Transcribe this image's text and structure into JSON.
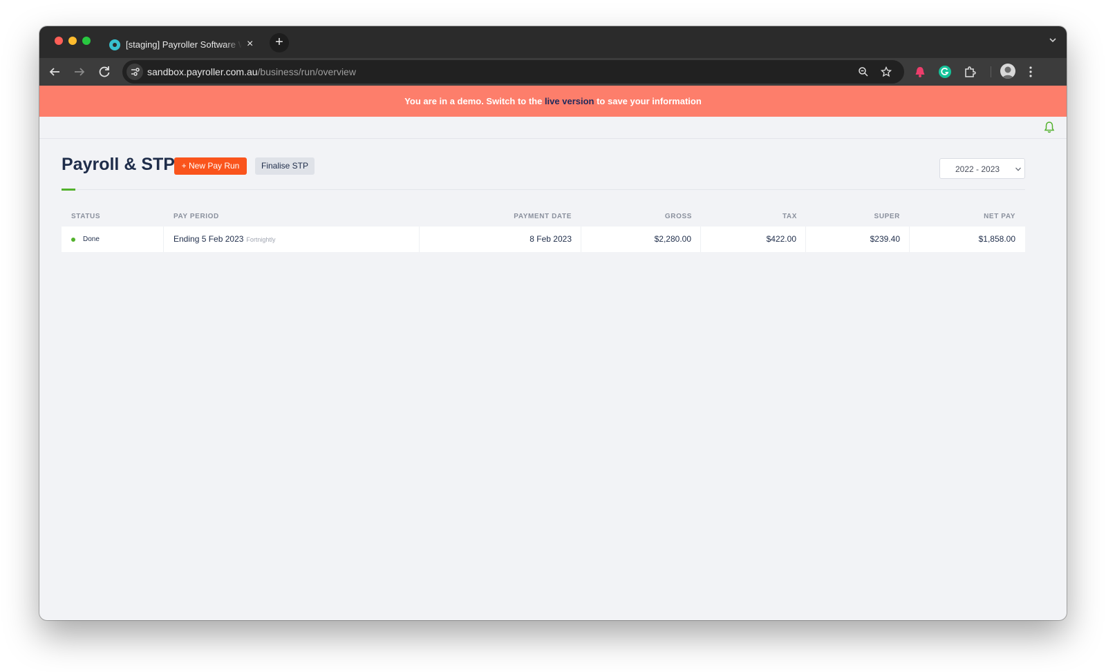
{
  "browser": {
    "tab_title": "[staging] Payroller Software Web App",
    "tab_close": "×",
    "new_tab": "+",
    "url_host": "sandbox.payroller.com.au",
    "url_path": "/business/run/overview"
  },
  "banner": {
    "text_before": "You are in a demo. Switch to the ",
    "link": "live version",
    "text_after": " to save your information"
  },
  "page": {
    "title": "Payroll & STP",
    "new_pay_run_button": "+ New Pay Run",
    "finalise_stp_button": "Finalise STP",
    "financial_year": "2022 - 2023"
  },
  "table": {
    "headers": {
      "status": "STATUS",
      "pay_period": "PAY PERIOD",
      "payment_date": "PAYMENT DATE",
      "gross": "GROSS",
      "tax": "TAX",
      "super": "SUPER",
      "net_pay": "NET PAY"
    },
    "rows": [
      {
        "status": "Done",
        "pay_period": "Ending 5 Feb 2023",
        "frequency": "Fortnightly",
        "payment_date": "8 Feb 2023",
        "gross": "$2,280.00",
        "tax": "$422.00",
        "super": "$239.40",
        "net_pay": "$1,858.00"
      }
    ]
  },
  "colors": {
    "banner": "#fd7e6b",
    "primary_button": "#fa541c",
    "accent_green": "#52b12c",
    "title": "#1f2d4a"
  },
  "icons": [
    "back-icon",
    "forward-icon",
    "reload-icon",
    "site-settings-icon",
    "zoom-icon",
    "bookmark-star-icon",
    "extension-icon",
    "grammarly-icon",
    "puzzle-icon",
    "profile-avatar",
    "more-menu-icon",
    "bell-icon",
    "chevron-down-icon"
  ]
}
